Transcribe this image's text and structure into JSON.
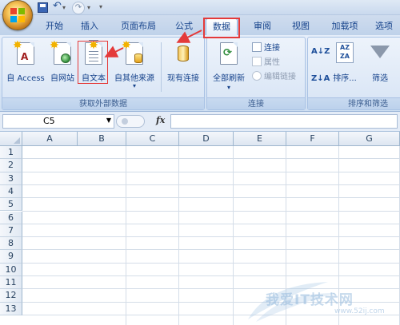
{
  "tabs": [
    {
      "label": "开始",
      "active": false
    },
    {
      "label": "插入",
      "active": false
    },
    {
      "label": "页面布局",
      "active": false
    },
    {
      "label": "公式",
      "active": false
    },
    {
      "label": "数据",
      "active": true
    },
    {
      "label": "审阅",
      "active": false
    },
    {
      "label": "视图",
      "active": false
    },
    {
      "label": "加载项",
      "active": false
    },
    {
      "label": "选项",
      "active": false
    }
  ],
  "groups": {
    "external": {
      "label": "获取外部数据",
      "buttons": {
        "access": "自 Access",
        "web": "自网站",
        "text": "自文本",
        "other": "自其他来源",
        "existing": "现有连接"
      }
    },
    "connections": {
      "label": "连接",
      "refresh_all": "全部刷新",
      "connections": "连接",
      "properties": "属性",
      "edit_links": "编辑链接"
    },
    "sort_filter": {
      "label": "排序和筛选",
      "sort": "排序...",
      "filter": "筛选"
    }
  },
  "formula_bar": {
    "name_box": "C5",
    "fx": "fx",
    "formula": ""
  },
  "columns": [
    "A",
    "B",
    "C",
    "D",
    "E",
    "F",
    "G"
  ],
  "rows": [
    "1",
    "2",
    "3",
    "4",
    "5",
    "6",
    "7",
    "8",
    "9",
    "10",
    "11",
    "12",
    "13"
  ],
  "watermark": {
    "text": "我爱IT技术网",
    "url": "www.52ij.com"
  },
  "colors": {
    "highlight": "#e43a3a",
    "ribbon_text": "#15428b"
  }
}
